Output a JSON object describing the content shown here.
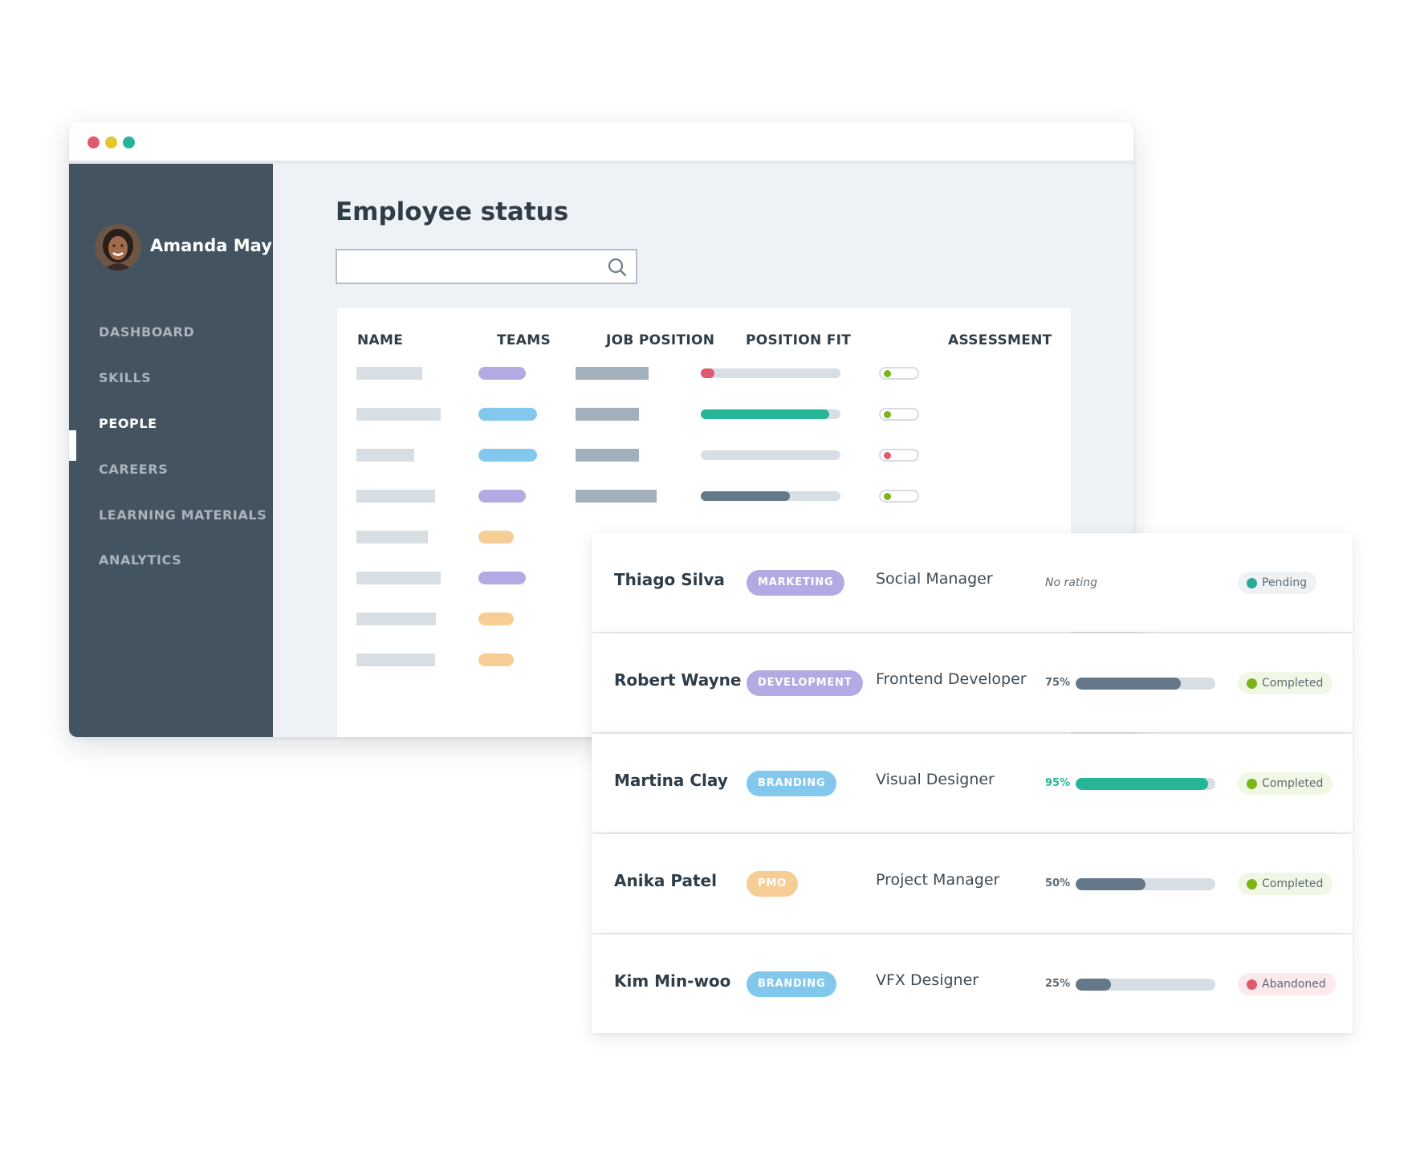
{
  "window": {
    "controls": [
      {
        "name": "close",
        "color": "#e05a6f"
      },
      {
        "name": "minimize",
        "color": "#e4c72d"
      },
      {
        "name": "maximize",
        "color": "#27b59a"
      }
    ]
  },
  "user": {
    "name": "Amanda May"
  },
  "nav": {
    "items": [
      {
        "label": "DASHBOARD",
        "active": false
      },
      {
        "label": "SKILLS",
        "active": false
      },
      {
        "label": "PEOPLE",
        "active": true
      },
      {
        "label": "CAREERS",
        "active": false
      },
      {
        "label": "LEARNING MATERIALS",
        "active": false
      },
      {
        "label": "ANALYTICS",
        "active": false
      }
    ]
  },
  "page": {
    "title": "Employee status"
  },
  "search": {
    "value": "",
    "placeholder": "",
    "icon": "search-icon"
  },
  "table": {
    "columns": [
      "NAME",
      "TEAMS",
      "JOB POSITION",
      "POSITION FIT",
      "ASSESSMENT"
    ],
    "rows": [
      {
        "team_color": "#b2aae3",
        "fit_fraction": 0.1,
        "fit_color": "#e05a6f",
        "assessment_color": "#7cb518"
      },
      {
        "team_color": "#82c8ec",
        "fit_fraction": 0.92,
        "fit_color": "#27b59a",
        "assessment_color": "#7cb518"
      },
      {
        "team_color": "#82c8ec",
        "fit_fraction": 0,
        "fit_color": "#d7dee4",
        "assessment_color": "#e05a6f"
      },
      {
        "team_color": "#b2aae3",
        "fit_fraction": 0.64,
        "fit_color": "#647889",
        "assessment_color": "#7cb518"
      },
      {
        "team_color": "#f7cd96"
      },
      {
        "team_color": "#b2aae3"
      },
      {
        "team_color": "#f7cd96"
      },
      {
        "team_color": "#f7cd96"
      }
    ]
  },
  "employees": [
    {
      "name": "Thiago Silva",
      "team": "MARKETING",
      "team_color": "#b2aae3",
      "job": "Social Manager",
      "rating_text": "No rating",
      "fit_percent": null,
      "status": "Pending",
      "status_dot": "#2aa79b",
      "status_bg": "#eef2f5",
      "status_text": "#5e6a74"
    },
    {
      "name": "Robert Wayne",
      "team": "DEVELOPMENT",
      "team_color": "#b2aae3",
      "job": "Frontend Developer",
      "fit_label": "75%",
      "fit_percent": 75,
      "fit_color": "#647889",
      "fit_text_color": "#5e6a74",
      "status": "Completed",
      "status_dot": "#7cb518",
      "status_bg": "#f1f7e5",
      "status_text": "#5e6a74"
    },
    {
      "name": "Martina Clay",
      "team": "BRANDING",
      "team_color": "#82c8ec",
      "job": "Visual Designer",
      "fit_label": "95%",
      "fit_percent": 95,
      "fit_color": "#27b59a",
      "fit_text_color": "#27b59a",
      "status": "Completed",
      "status_dot": "#7cb518",
      "status_bg": "#f1f7e5",
      "status_text": "#5e6a74"
    },
    {
      "name": "Anika Patel",
      "team": "PMO",
      "team_color": "#f7cd96",
      "job": "Project Manager",
      "fit_label": "50%",
      "fit_percent": 50,
      "fit_color": "#647889",
      "fit_text_color": "#5e6a74",
      "status": "Completed",
      "status_dot": "#7cb518",
      "status_bg": "#f1f7e5",
      "status_text": "#5e6a74"
    },
    {
      "name": "Kim Min-woo",
      "team": "BRANDING",
      "team_color": "#82c8ec",
      "job": "VFX Designer",
      "fit_label": "25%",
      "fit_percent": 25,
      "fit_color": "#647889",
      "fit_text_color": "#5e6a74",
      "status": "Abandoned",
      "status_dot": "#e05a6f",
      "status_bg": "#fbe9ec",
      "status_text": "#5e6a74"
    }
  ]
}
